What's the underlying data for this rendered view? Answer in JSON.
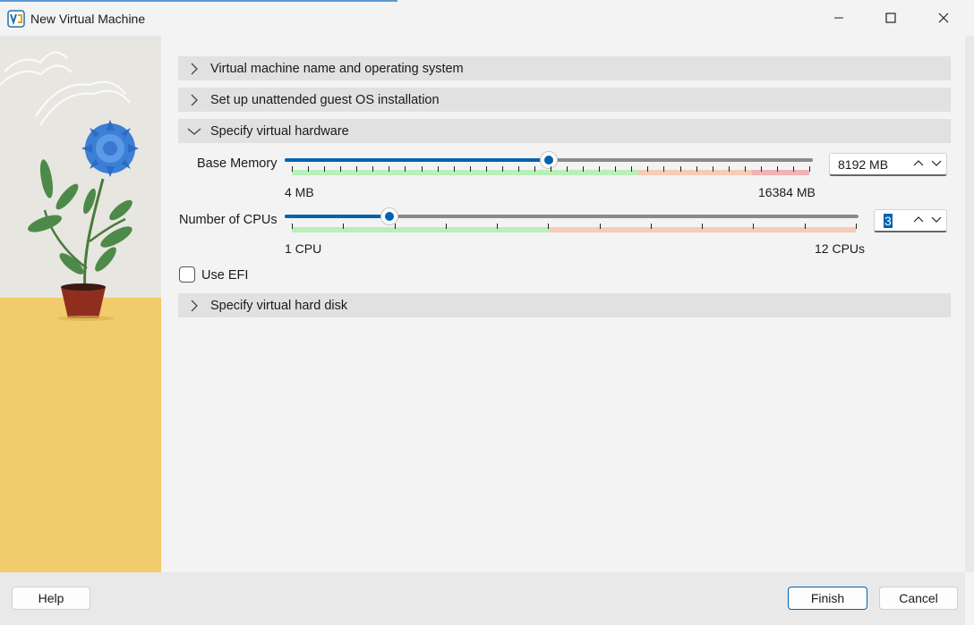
{
  "window": {
    "title": "New Virtual Machine"
  },
  "sections": [
    {
      "label": "Virtual machine name and operating system",
      "expanded": false
    },
    {
      "label": "Set up unattended guest OS installation",
      "expanded": false
    },
    {
      "label": "Specify virtual hardware",
      "expanded": true
    },
    {
      "label": "Specify virtual hard disk",
      "expanded": false
    }
  ],
  "hardware": {
    "memory": {
      "label": "Base Memory",
      "value_text": "8192 MB",
      "value": 8192,
      "min": 4,
      "max": 16384,
      "min_label": "4 MB",
      "max_label": "16384 MB"
    },
    "cpus": {
      "label": "Number of CPUs",
      "value_text": "3",
      "value": 3,
      "min": 1,
      "max": 12,
      "min_label": "1 CPU",
      "max_label": "12 CPUs"
    },
    "efi": {
      "label": "Use EFI",
      "checked": false
    }
  },
  "buttons": {
    "help": "Help",
    "finish": "Finish",
    "cancel": "Cancel"
  },
  "colors": {
    "accent": "#0063b1",
    "scale_green": "#b8f0b8",
    "scale_orange": "#f7cbb6",
    "scale_red": "#f2b3b8"
  }
}
